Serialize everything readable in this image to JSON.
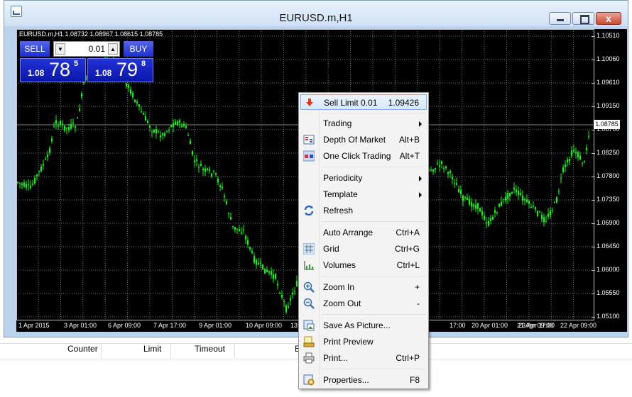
{
  "window": {
    "title": "EURUSD.m,H1",
    "close_glyph": "x"
  },
  "chart": {
    "info": "EURUSD.m,H1  1.08732 1.08967 1.08615 1.08785",
    "current_price": "1.08785",
    "price_levels": [
      "1.10510",
      "1.10060",
      "1.09610",
      "1.09150",
      "1.08700",
      "1.08250",
      "1.07800",
      "1.07350",
      "1.06900",
      "1.06450",
      "1.06000",
      "1.05550",
      "1.05100"
    ],
    "time_labels": [
      "1 Apr 2015",
      "3 Apr 01:00",
      "6 Apr 09:00",
      "7 Apr 17:00",
      "9 Apr 01:00",
      "10 Apr 09:00",
      "13 A",
      "17:00",
      "20 Apr 01:00",
      "21 Apr 09:00",
      "22 Apr 09:00",
      "23 Apr 17:00"
    ],
    "colors": {
      "background": "#000000",
      "candles": "#00ff00",
      "grid": "#c0c0c0"
    },
    "grid": true
  },
  "trade_panel": {
    "sell_label": "SELL",
    "buy_label": "BUY",
    "lot": "0.01",
    "sell_price": {
      "prefix": "1.08",
      "big": "78",
      "sup": "5"
    },
    "buy_price": {
      "prefix": "1.08",
      "big": "79",
      "sup": "8"
    }
  },
  "bottom_panel": {
    "columns": [
      "Counter",
      "Limit",
      "Timeout",
      "E"
    ]
  },
  "context_menu": {
    "items": [
      {
        "label": "Sell Limit 0.01",
        "shortcut": "1.09426",
        "icon": "sell-limit-icon",
        "highlighted": true
      },
      {
        "label": "Trading",
        "shortcut": "",
        "icon": "",
        "submenu": true
      },
      {
        "label": "Depth Of Market",
        "shortcut": "Alt+B",
        "icon": "depth-of-market-icon"
      },
      {
        "label": "One Click Trading",
        "shortcut": "Alt+T",
        "icon": "one-click-trading-icon"
      },
      {
        "label": "Periodicity",
        "shortcut": "",
        "icon": "",
        "submenu": true
      },
      {
        "label": "Template",
        "shortcut": "",
        "icon": "",
        "submenu": true
      },
      {
        "label": "Refresh",
        "shortcut": "",
        "icon": "refresh-icon"
      },
      {
        "label": "Auto Arrange",
        "shortcut": "Ctrl+A",
        "icon": ""
      },
      {
        "label": "Grid",
        "shortcut": "Ctrl+G",
        "icon": "grid-icon"
      },
      {
        "label": "Volumes",
        "shortcut": "Ctrl+L",
        "icon": "volumes-icon"
      },
      {
        "label": "Zoom In",
        "shortcut": "+",
        "icon": "zoom-in-icon"
      },
      {
        "label": "Zoom Out",
        "shortcut": "-",
        "icon": "zoom-out-icon"
      },
      {
        "label": "Save As Picture...",
        "shortcut": "",
        "icon": "save-picture-icon"
      },
      {
        "label": "Print Preview",
        "shortcut": "",
        "icon": "print-preview-icon"
      },
      {
        "label": "Print...",
        "shortcut": "Ctrl+P",
        "icon": "print-icon"
      },
      {
        "label": "Properties...",
        "shortcut": "F8",
        "icon": "properties-icon"
      }
    ]
  }
}
